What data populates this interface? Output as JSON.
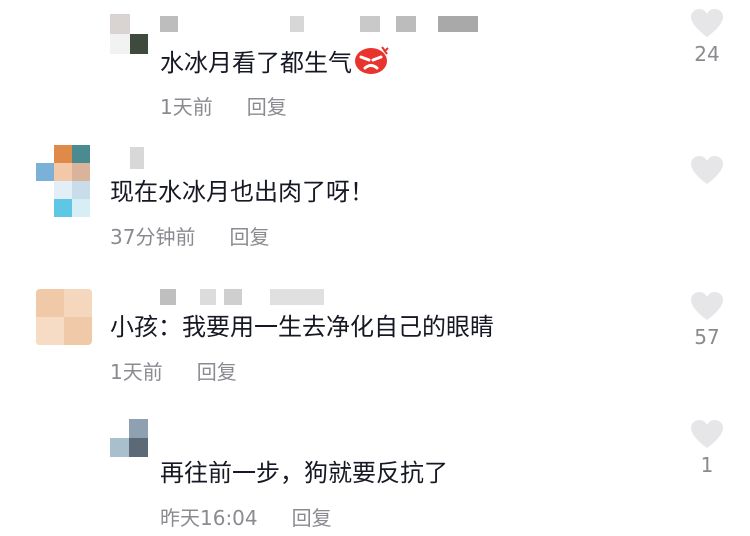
{
  "comments": [
    {
      "text": "水冰月看了都生气",
      "emoji": "angry-face-emoji",
      "time": "1天前",
      "reply": "回复",
      "likes": "24"
    },
    {
      "text": "现在水冰月也出肉了呀！",
      "time": "37分钟前",
      "reply": "回复",
      "likes": ""
    },
    {
      "text": "小孩：我要用一生去净化自己的眼睛",
      "time": "1天前",
      "reply": "回复",
      "likes": "57"
    },
    {
      "text": "再往前一步，狗就要反抗了",
      "time": "昨天16:04",
      "reply": "回复",
      "likes": "1"
    }
  ],
  "colors": {
    "text": "#161823",
    "meta": "#8a8b91",
    "heart": "#e6e6e8",
    "angry": "#e8342c"
  }
}
